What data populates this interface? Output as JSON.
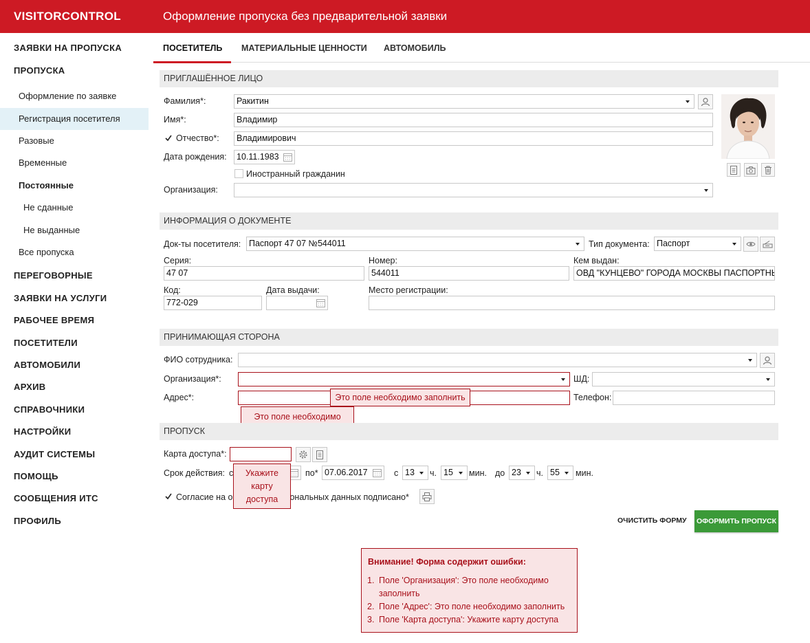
{
  "app": {
    "brand": "VISITORCONTROL",
    "title": "Оформление пропуска без предварительной заявки"
  },
  "sidebar": {
    "top1": "ЗАЯВКИ НА ПРОПУСКА",
    "top2": "ПРОПУСКА",
    "sub": [
      "Оформление по заявке",
      "Регистрация посетителя",
      "Разовые",
      "Временные",
      "Постоянные",
      "Не сданные",
      "Не выданные",
      "Все пропуска"
    ],
    "rest": [
      "ПЕРЕГОВОРНЫЕ",
      "ЗАЯВКИ НА УСЛУГИ",
      "РАБОЧЕЕ ВРЕМЯ",
      "ПОСЕТИТЕЛИ",
      "АВТОМОБИЛИ",
      "АРХИВ",
      "СПРАВОЧНИКИ",
      "НАСТРОЙКИ",
      "АУДИТ СИСТЕМЫ",
      "ПОМОЩЬ",
      "СООБЩЕНИЯ ИТС",
      "ПРОФИЛЬ"
    ]
  },
  "tabs": [
    "ПОСЕТИТЕЛЬ",
    "МАТЕРИАЛЬНЫЕ ЦЕННОСТИ",
    "АВТОМОБИЛЬ"
  ],
  "invited": {
    "header": "ПРИГЛАШЁННОЕ ЛИЦО",
    "surname_label": "Фамилия*:",
    "surname": "Ракитин",
    "name_label": "Имя*:",
    "name": "Владимир",
    "patronymic_label": "Отчество*:",
    "patronymic": "Владимирович",
    "birth_label": "Дата рождения:",
    "birth": "10.11.1983",
    "foreign_label": "Иностранный гражданин",
    "org_label": "Организация:",
    "org": ""
  },
  "document": {
    "header": "ИНФОРМАЦИЯ О ДОКУМЕНТЕ",
    "docs_label": "Док-ты посетителя:",
    "docs": "Паспорт 47 07 №544011",
    "type_label": "Тип документа:",
    "type": "Паспорт",
    "series_label": "Серия:",
    "series": "47 07",
    "number_label": "Номер:",
    "number": "544011",
    "issuer_label": "Кем выдан:",
    "issuer": "ОВД \"КУНЦЕВО\" ГОРОДА МОСКВЫ ПАСПОРТНЫ",
    "code_label": "Код:",
    "code": "772-029",
    "issue_date_label": "Дата выдачи:",
    "issue_date": "",
    "reg_label": "Место регистрации:",
    "reg": ""
  },
  "host": {
    "header": "ПРИНИМАЮЩАЯ СТОРОНА",
    "employee_label": "ФИО сотрудника:",
    "employee": "",
    "org_label": "Организация*:",
    "org": "",
    "sd_label": "ШД:",
    "sd": "",
    "address_label": "Адрес*:",
    "address": "",
    "phone_label": "Телефон:",
    "phone": "",
    "org_error": "Это поле необходимо заполнить",
    "address_error": "Это поле необходимо заполнить"
  },
  "pass": {
    "header": "ПРОПУСК",
    "card_label": "Карта доступа*:",
    "card": "",
    "card_error": "Укажите карту доступа",
    "validity_label": "Срок действия:",
    "from_prefix": "с",
    "to_label": "по*",
    "to_date": "07.06.2017",
    "time_from_prefix": "с",
    "time_from_h": "13",
    "time_from_m": "15",
    "time_to_prefix": "до",
    "time_to_h": "23",
    "time_to_m": "55",
    "hours_unit": "ч.",
    "minutes_unit": "мин.",
    "consent_label": "Согласие на обработку персональных данных подписано*"
  },
  "actions": {
    "clear": "ОЧИСТИТЬ ФОРМУ",
    "submit": "ОФОРМИТЬ ПРОПУСК"
  },
  "errors": {
    "title": "Внимание! Форма содержит ошибки:",
    "items": [
      "Поле 'Организация': Это поле необходимо",
      "заполнить",
      "Поле 'Адрес': Это поле необходимо заполнить",
      "Поле 'Карта доступа': Укажите карту доступа"
    ]
  },
  "colors": {
    "brand_red": "#cd1a24",
    "error_red": "#a8101a",
    "submit_green": "#3b9a38",
    "active_nav": "#e3f1f7"
  }
}
